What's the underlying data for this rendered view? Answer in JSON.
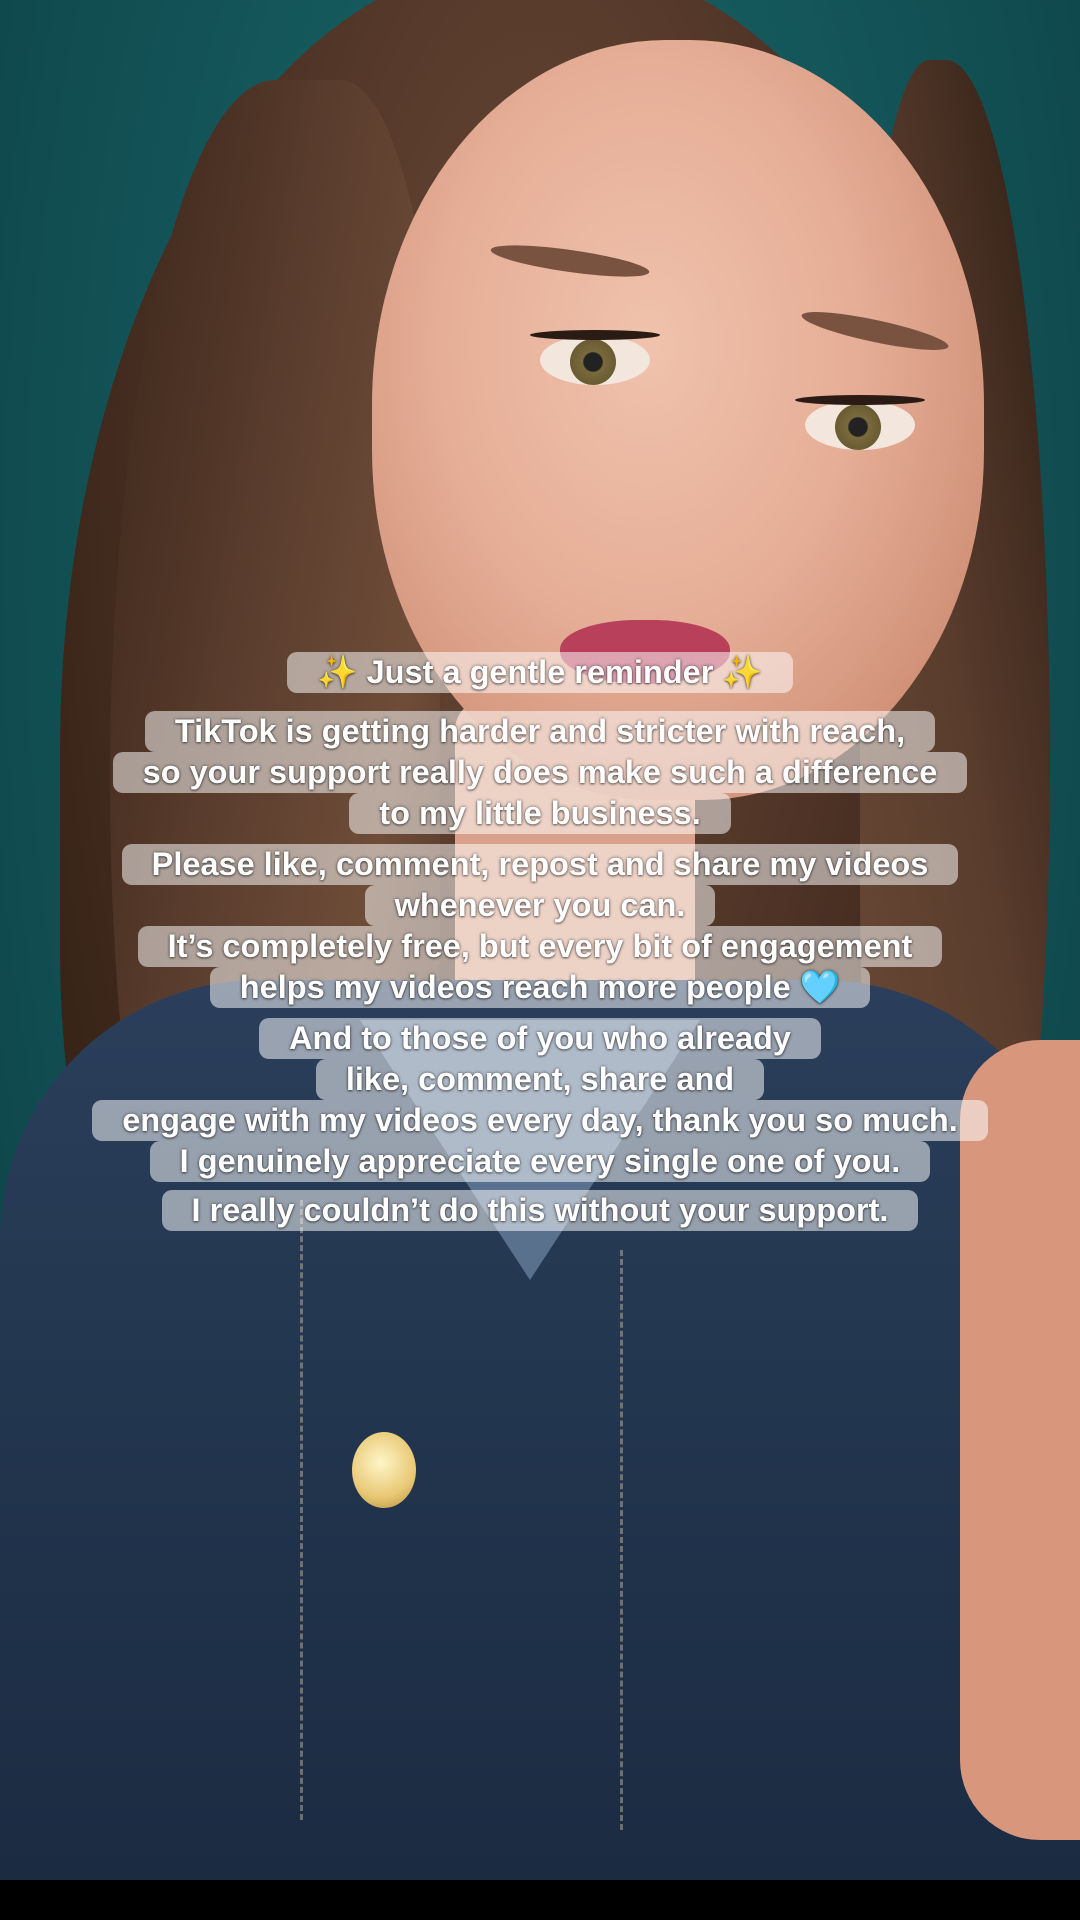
{
  "caption": {
    "blocks": [
      {
        "lines": [
          "✨ Just a gentle reminder ✨"
        ]
      },
      {
        "lines": [
          "TikTok is getting harder and stricter with reach,",
          "so your support really does make such a difference",
          "to my little business."
        ]
      },
      {
        "lines": [
          "Please like, comment, repost and share my videos",
          "whenever you can.",
          "It’s completely free, but every bit of engagement",
          "helps my videos reach more people 🩵"
        ]
      },
      {
        "lines": [
          "And to those of you who already",
          "like, comment, share and",
          "engage with my videos every day, thank you so much.",
          "I genuinely appreciate every single one of you."
        ]
      },
      {
        "lines": [
          "I really couldn’t do this without your support."
        ]
      }
    ]
  },
  "colors": {
    "background": "#14565a",
    "caption_bg": "rgba(255,255,255,0.52)",
    "caption_text": "#ffffff"
  }
}
